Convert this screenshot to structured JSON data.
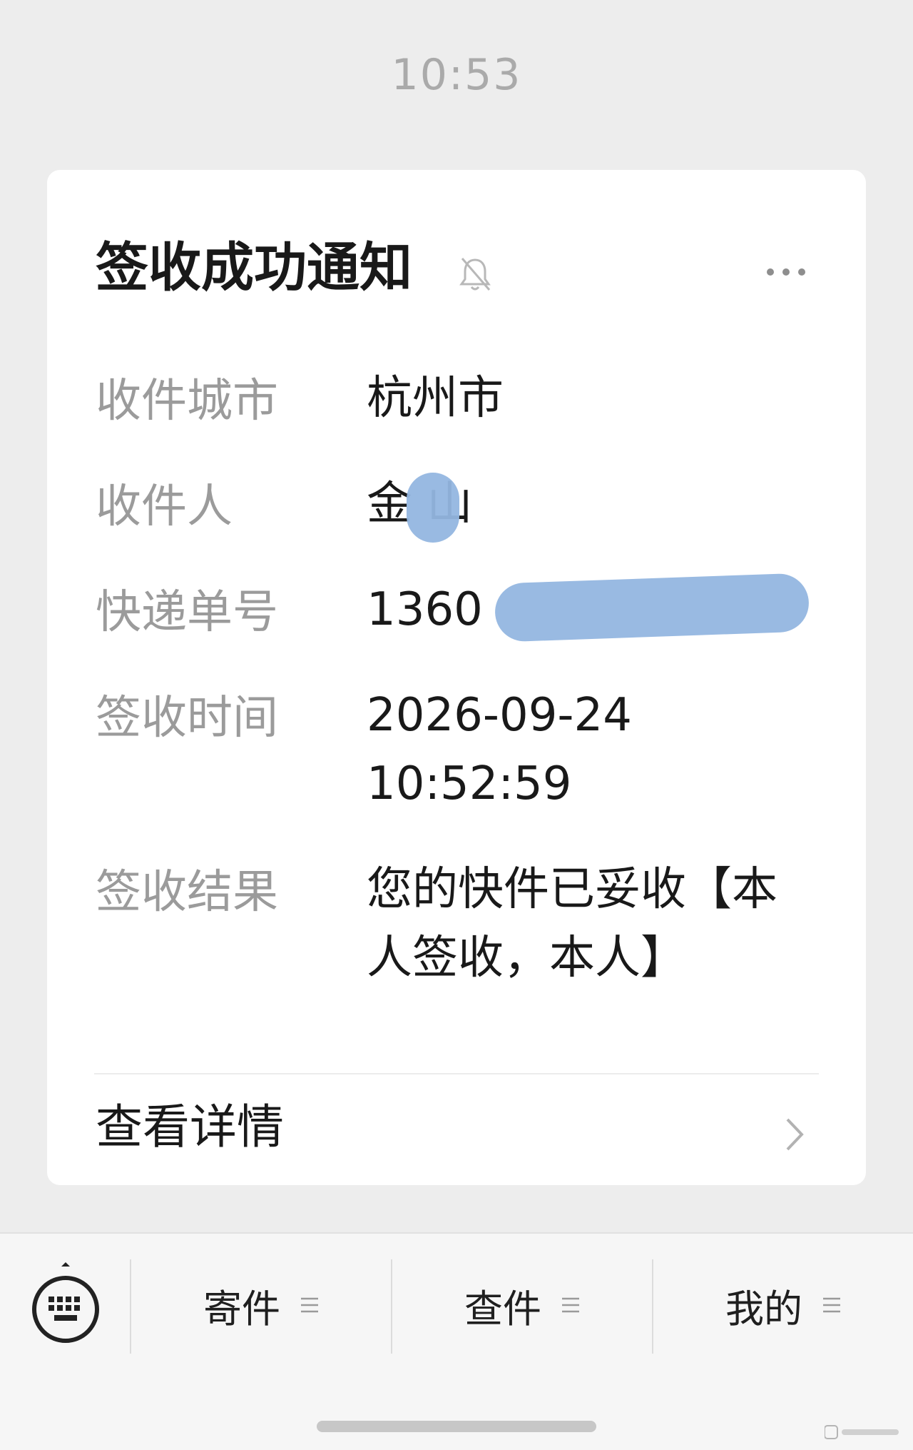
{
  "chat": {
    "time": "10:53"
  },
  "card": {
    "title": "签收成功通知",
    "fields": [
      {
        "label": "收件城市",
        "value": "杭州市"
      },
      {
        "label": "收件人",
        "value": "金 山"
      },
      {
        "label": "快递单号",
        "value": "1360"
      },
      {
        "label": "签收时间",
        "value_line1": "2026-09-24",
        "value_line2": "10:52:59"
      },
      {
        "label": "签收结果",
        "value_line1": "您的快件已妥收【本",
        "value_line2": "人签收，本人】"
      }
    ],
    "detail_label": "查看详情"
  },
  "bottom_menu": {
    "items": [
      {
        "label": "寄件"
      },
      {
        "label": "查件"
      },
      {
        "label": "我的"
      }
    ]
  },
  "icons": {
    "bell": "bell-muted-icon",
    "more": "more-dots-icon",
    "chevron": "chevron-right-icon",
    "keyboard": "keyboard-icon",
    "menu": "menu-lines-icon"
  },
  "colors": {
    "background": "#ededed",
    "card": "#ffffff",
    "label_gray": "#9b9b9b",
    "text_dark": "#191919",
    "redaction_blue": "#94b6e0"
  }
}
